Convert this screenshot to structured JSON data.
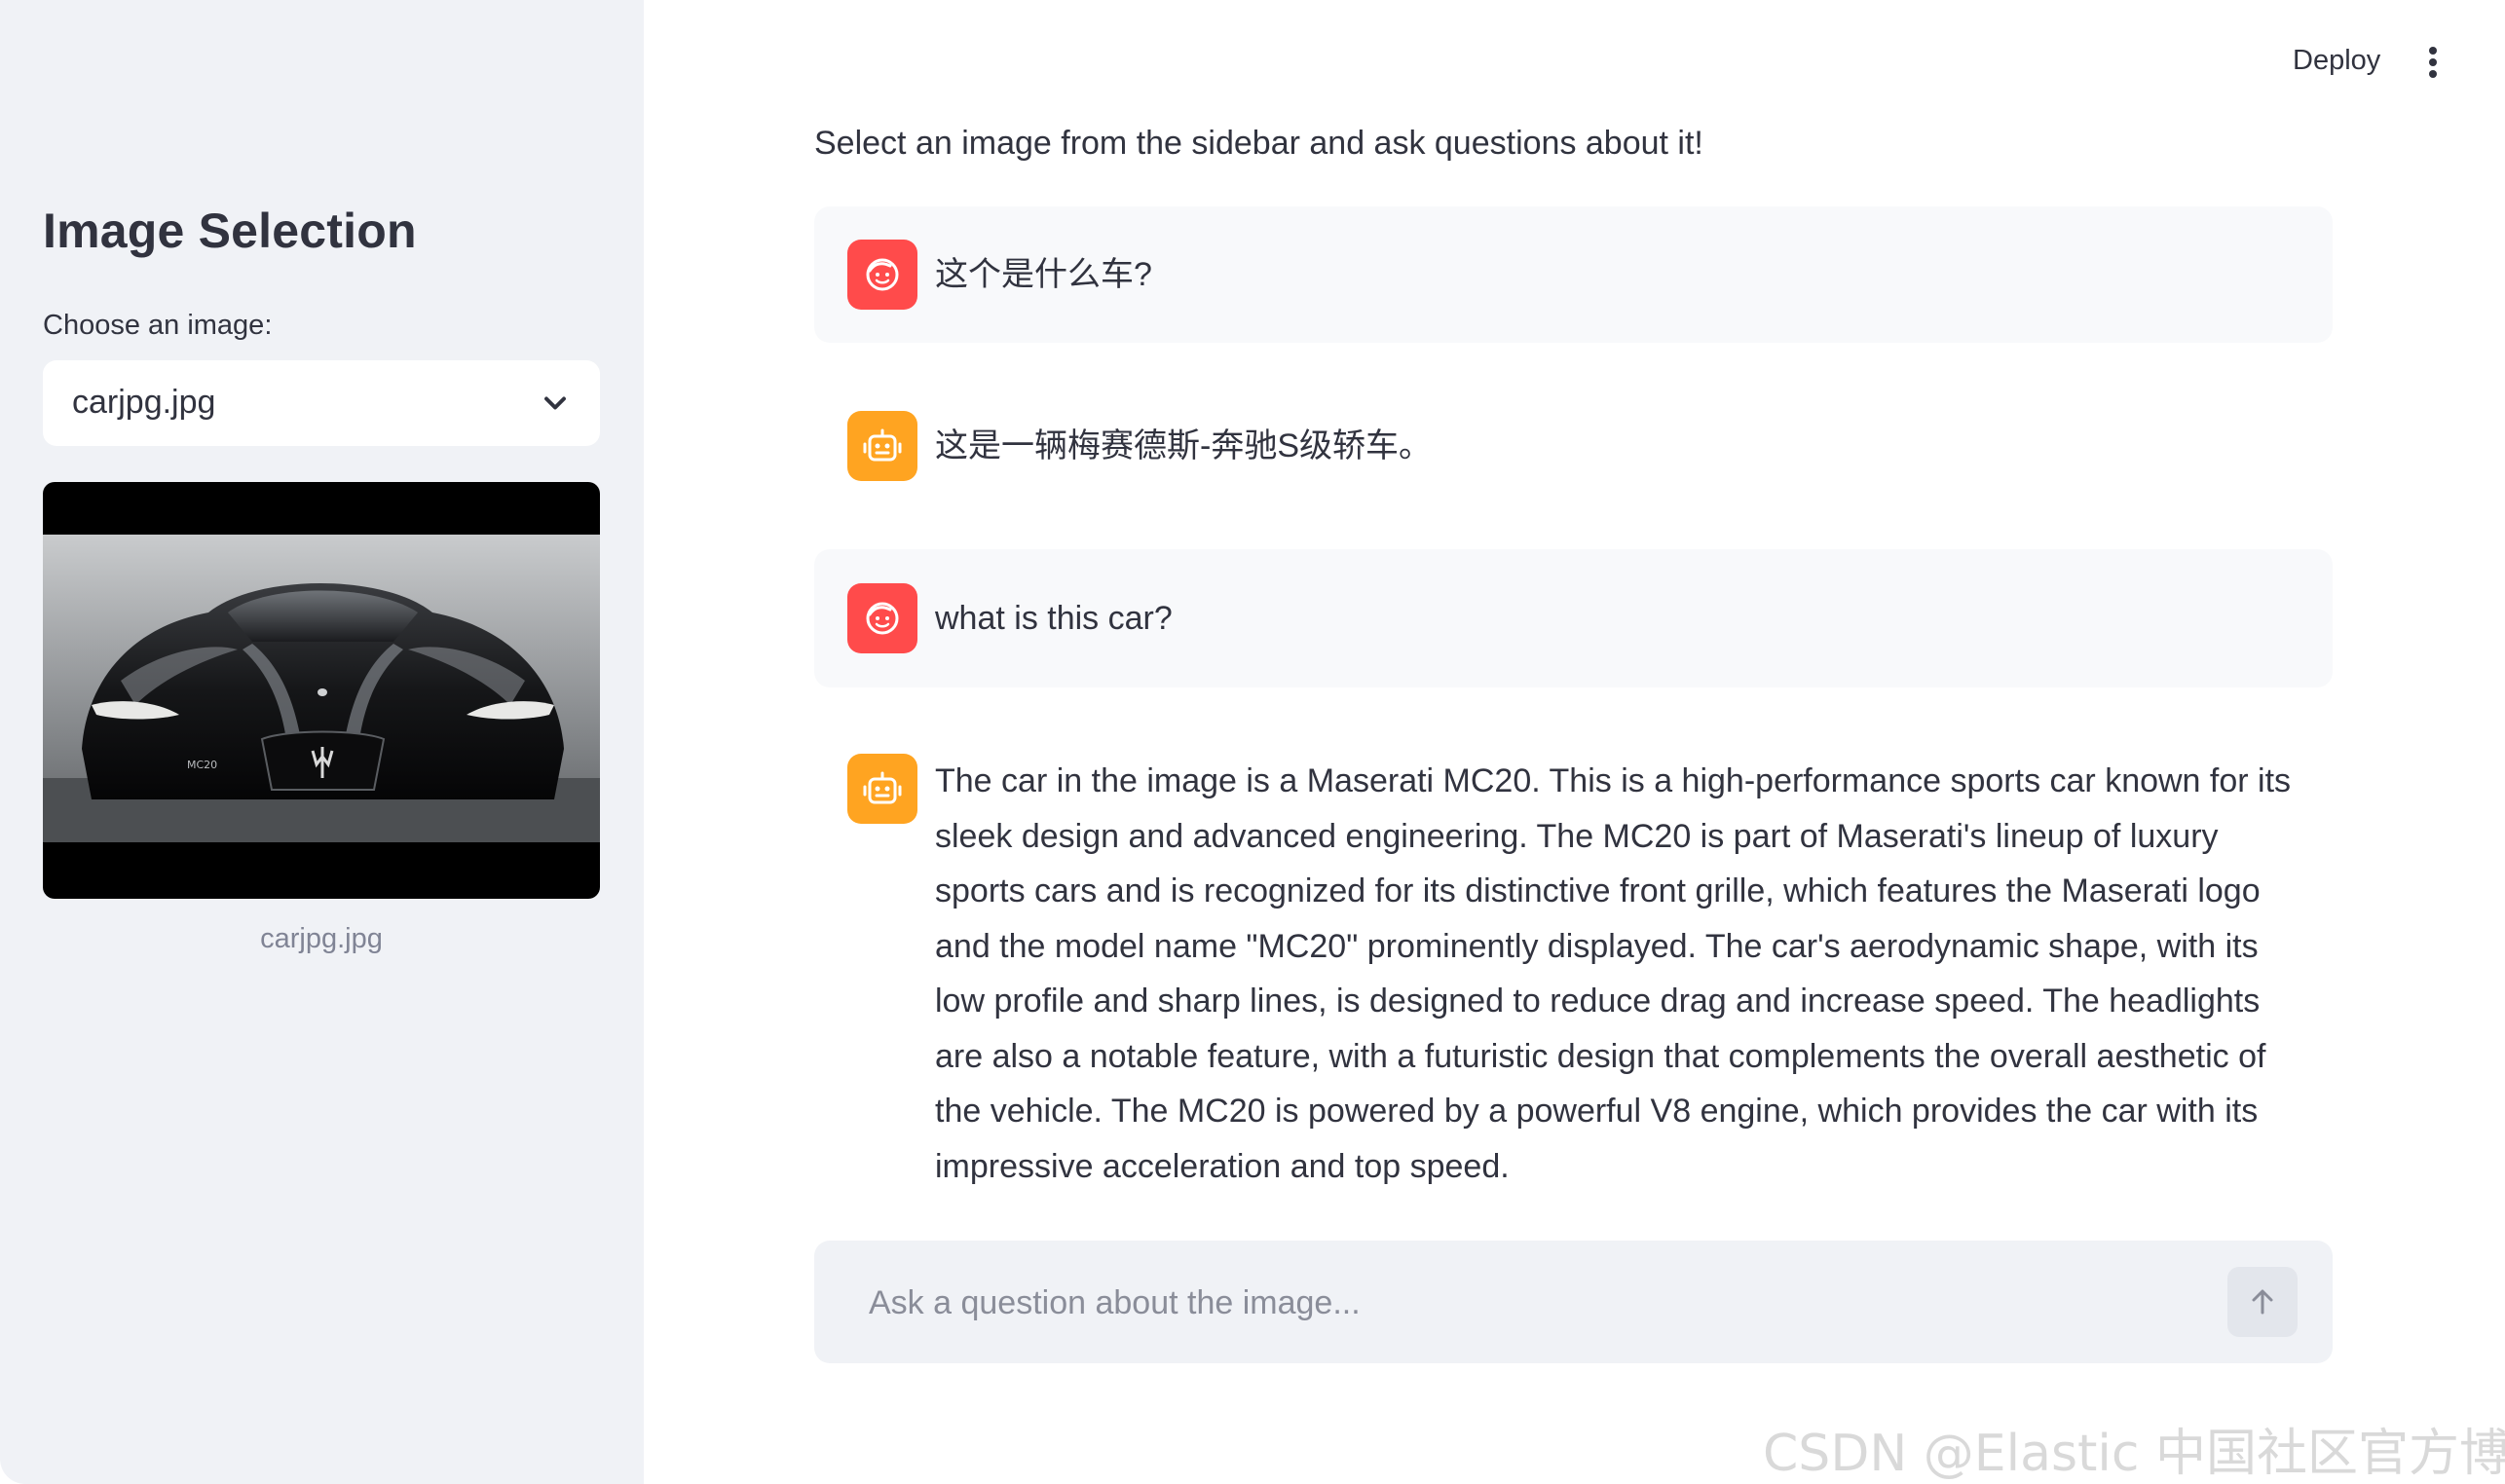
{
  "sidebar": {
    "title": "Image Selection",
    "select_label": "Choose an image:",
    "selected_image": "carjpg.jpg",
    "image_caption": "carjpg.jpg",
    "image_icon": "car-photo"
  },
  "header": {
    "deploy_label": "Deploy",
    "menu_icon": "kebab-menu-icon"
  },
  "main": {
    "intro": "Select an image from the sidebar and ask questions about it!",
    "messages": [
      {
        "role": "user",
        "avatar_icon": "user-face-icon",
        "text": "这个是什么车?"
      },
      {
        "role": "assistant",
        "avatar_icon": "robot-icon",
        "text": "这是一辆梅赛德斯-奔驰S级轿车。"
      },
      {
        "role": "user",
        "avatar_icon": "user-face-icon",
        "text": "what is this car?"
      },
      {
        "role": "assistant",
        "avatar_icon": "robot-icon",
        "text": "The car in the image is a Maserati MC20. This is a high-performance sports car known for its sleek design and advanced engineering. The MC20 is part of Maserati's lineup of luxury sports cars and is recognized for its distinctive front grille, which features the Maserati logo and the model name \"MC20\" prominently displayed. The car's aerodynamic shape, with its low profile and sharp lines, is designed to reduce drag and increase speed. The headlights are also a notable feature, with a futuristic design that complements the overall aesthetic of the vehicle. The MC20 is powered by a powerful V8 engine, which provides the car with its impressive acceleration and top speed."
      }
    ],
    "chat_input": {
      "placeholder": "Ask a question about the image...",
      "value": "",
      "send_icon": "arrow-up-icon"
    }
  },
  "watermark": "CSDN @Elastic 中国社区官方博客",
  "colors": {
    "sidebar_bg": "#f0f2f6",
    "user_avatar": "#ff4b4b",
    "assistant_avatar": "#ffa421",
    "text": "#31333f"
  }
}
